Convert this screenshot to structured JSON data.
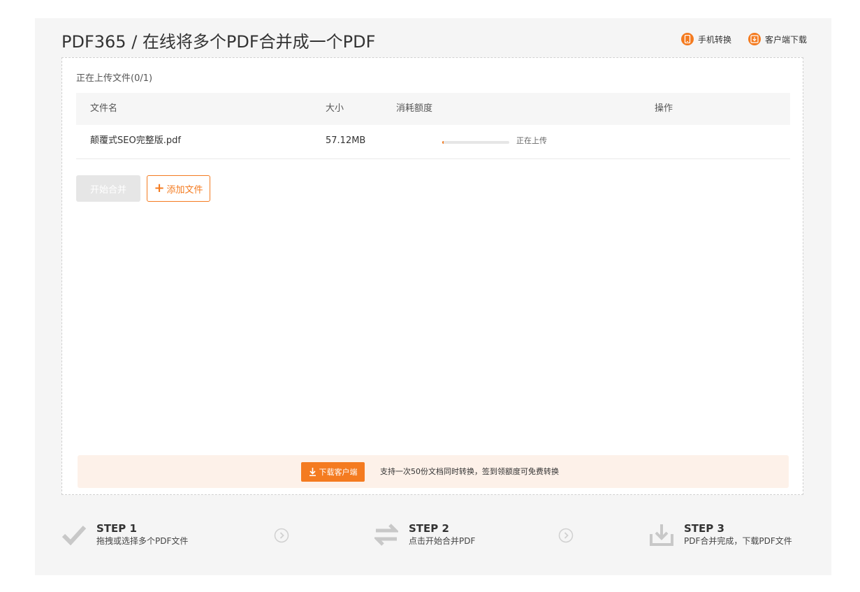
{
  "page": {
    "title": "PDF365 / 在线将多个PDF合并成一个PDF",
    "accent_color": "#f47b20"
  },
  "top_links": {
    "mobile": {
      "label": "手机转换",
      "icon": "mobile-phone-icon"
    },
    "client": {
      "label": "客户端下载",
      "icon": "download-icon"
    }
  },
  "upload": {
    "status_label": "正在上传文件(0/1)",
    "columns": {
      "name": "文件名",
      "size": "大小",
      "quota": "消耗额度",
      "actions": "操作"
    },
    "files": [
      {
        "name": "颠覆式SEO完整版.pdf",
        "size": "57.12MB",
        "progress": 0.02,
        "status": "正在上传"
      }
    ]
  },
  "actions": {
    "merge_label": "开始合并",
    "add_label": "添加文件"
  },
  "promo": {
    "button_label": "下载客户端",
    "text": "支持一次50份文档同时转换，签到领额度可免费转换"
  },
  "steps": [
    {
      "title": "STEP 1",
      "desc": "拖拽或选择多个PDF文件",
      "icon": "checkmark-icon"
    },
    {
      "title": "STEP 2",
      "desc": "点击开始合并PDF",
      "icon": "exchange-arrows-icon"
    },
    {
      "title": "STEP 3",
      "desc": "PDF合并完成，下载PDF文件",
      "icon": "tray-download-icon"
    }
  ]
}
